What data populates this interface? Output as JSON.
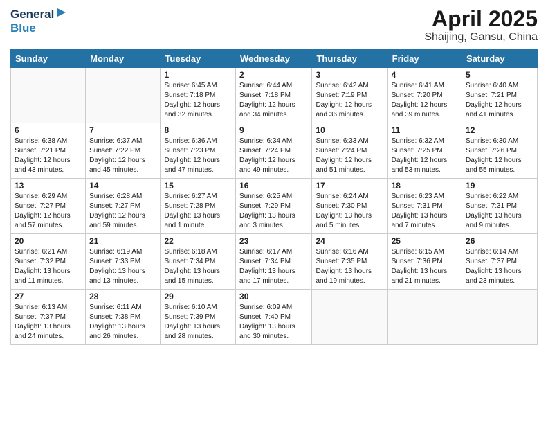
{
  "header": {
    "logo_line1": "General",
    "logo_line2": "Blue",
    "month_year": "April 2025",
    "location": "Shaijing, Gansu, China"
  },
  "days_of_week": [
    "Sunday",
    "Monday",
    "Tuesday",
    "Wednesday",
    "Thursday",
    "Friday",
    "Saturday"
  ],
  "weeks": [
    [
      {
        "day": "",
        "info": ""
      },
      {
        "day": "",
        "info": ""
      },
      {
        "day": "1",
        "info": "Sunrise: 6:45 AM\nSunset: 7:18 PM\nDaylight: 12 hours\nand 32 minutes."
      },
      {
        "day": "2",
        "info": "Sunrise: 6:44 AM\nSunset: 7:18 PM\nDaylight: 12 hours\nand 34 minutes."
      },
      {
        "day": "3",
        "info": "Sunrise: 6:42 AM\nSunset: 7:19 PM\nDaylight: 12 hours\nand 36 minutes."
      },
      {
        "day": "4",
        "info": "Sunrise: 6:41 AM\nSunset: 7:20 PM\nDaylight: 12 hours\nand 39 minutes."
      },
      {
        "day": "5",
        "info": "Sunrise: 6:40 AM\nSunset: 7:21 PM\nDaylight: 12 hours\nand 41 minutes."
      }
    ],
    [
      {
        "day": "6",
        "info": "Sunrise: 6:38 AM\nSunset: 7:21 PM\nDaylight: 12 hours\nand 43 minutes."
      },
      {
        "day": "7",
        "info": "Sunrise: 6:37 AM\nSunset: 7:22 PM\nDaylight: 12 hours\nand 45 minutes."
      },
      {
        "day": "8",
        "info": "Sunrise: 6:36 AM\nSunset: 7:23 PM\nDaylight: 12 hours\nand 47 minutes."
      },
      {
        "day": "9",
        "info": "Sunrise: 6:34 AM\nSunset: 7:24 PM\nDaylight: 12 hours\nand 49 minutes."
      },
      {
        "day": "10",
        "info": "Sunrise: 6:33 AM\nSunset: 7:24 PM\nDaylight: 12 hours\nand 51 minutes."
      },
      {
        "day": "11",
        "info": "Sunrise: 6:32 AM\nSunset: 7:25 PM\nDaylight: 12 hours\nand 53 minutes."
      },
      {
        "day": "12",
        "info": "Sunrise: 6:30 AM\nSunset: 7:26 PM\nDaylight: 12 hours\nand 55 minutes."
      }
    ],
    [
      {
        "day": "13",
        "info": "Sunrise: 6:29 AM\nSunset: 7:27 PM\nDaylight: 12 hours\nand 57 minutes."
      },
      {
        "day": "14",
        "info": "Sunrise: 6:28 AM\nSunset: 7:27 PM\nDaylight: 12 hours\nand 59 minutes."
      },
      {
        "day": "15",
        "info": "Sunrise: 6:27 AM\nSunset: 7:28 PM\nDaylight: 13 hours\nand 1 minute."
      },
      {
        "day": "16",
        "info": "Sunrise: 6:25 AM\nSunset: 7:29 PM\nDaylight: 13 hours\nand 3 minutes."
      },
      {
        "day": "17",
        "info": "Sunrise: 6:24 AM\nSunset: 7:30 PM\nDaylight: 13 hours\nand 5 minutes."
      },
      {
        "day": "18",
        "info": "Sunrise: 6:23 AM\nSunset: 7:31 PM\nDaylight: 13 hours\nand 7 minutes."
      },
      {
        "day": "19",
        "info": "Sunrise: 6:22 AM\nSunset: 7:31 PM\nDaylight: 13 hours\nand 9 minutes."
      }
    ],
    [
      {
        "day": "20",
        "info": "Sunrise: 6:21 AM\nSunset: 7:32 PM\nDaylight: 13 hours\nand 11 minutes."
      },
      {
        "day": "21",
        "info": "Sunrise: 6:19 AM\nSunset: 7:33 PM\nDaylight: 13 hours\nand 13 minutes."
      },
      {
        "day": "22",
        "info": "Sunrise: 6:18 AM\nSunset: 7:34 PM\nDaylight: 13 hours\nand 15 minutes."
      },
      {
        "day": "23",
        "info": "Sunrise: 6:17 AM\nSunset: 7:34 PM\nDaylight: 13 hours\nand 17 minutes."
      },
      {
        "day": "24",
        "info": "Sunrise: 6:16 AM\nSunset: 7:35 PM\nDaylight: 13 hours\nand 19 minutes."
      },
      {
        "day": "25",
        "info": "Sunrise: 6:15 AM\nSunset: 7:36 PM\nDaylight: 13 hours\nand 21 minutes."
      },
      {
        "day": "26",
        "info": "Sunrise: 6:14 AM\nSunset: 7:37 PM\nDaylight: 13 hours\nand 23 minutes."
      }
    ],
    [
      {
        "day": "27",
        "info": "Sunrise: 6:13 AM\nSunset: 7:37 PM\nDaylight: 13 hours\nand 24 minutes."
      },
      {
        "day": "28",
        "info": "Sunrise: 6:11 AM\nSunset: 7:38 PM\nDaylight: 13 hours\nand 26 minutes."
      },
      {
        "day": "29",
        "info": "Sunrise: 6:10 AM\nSunset: 7:39 PM\nDaylight: 13 hours\nand 28 minutes."
      },
      {
        "day": "30",
        "info": "Sunrise: 6:09 AM\nSunset: 7:40 PM\nDaylight: 13 hours\nand 30 minutes."
      },
      {
        "day": "",
        "info": ""
      },
      {
        "day": "",
        "info": ""
      },
      {
        "day": "",
        "info": ""
      }
    ]
  ]
}
